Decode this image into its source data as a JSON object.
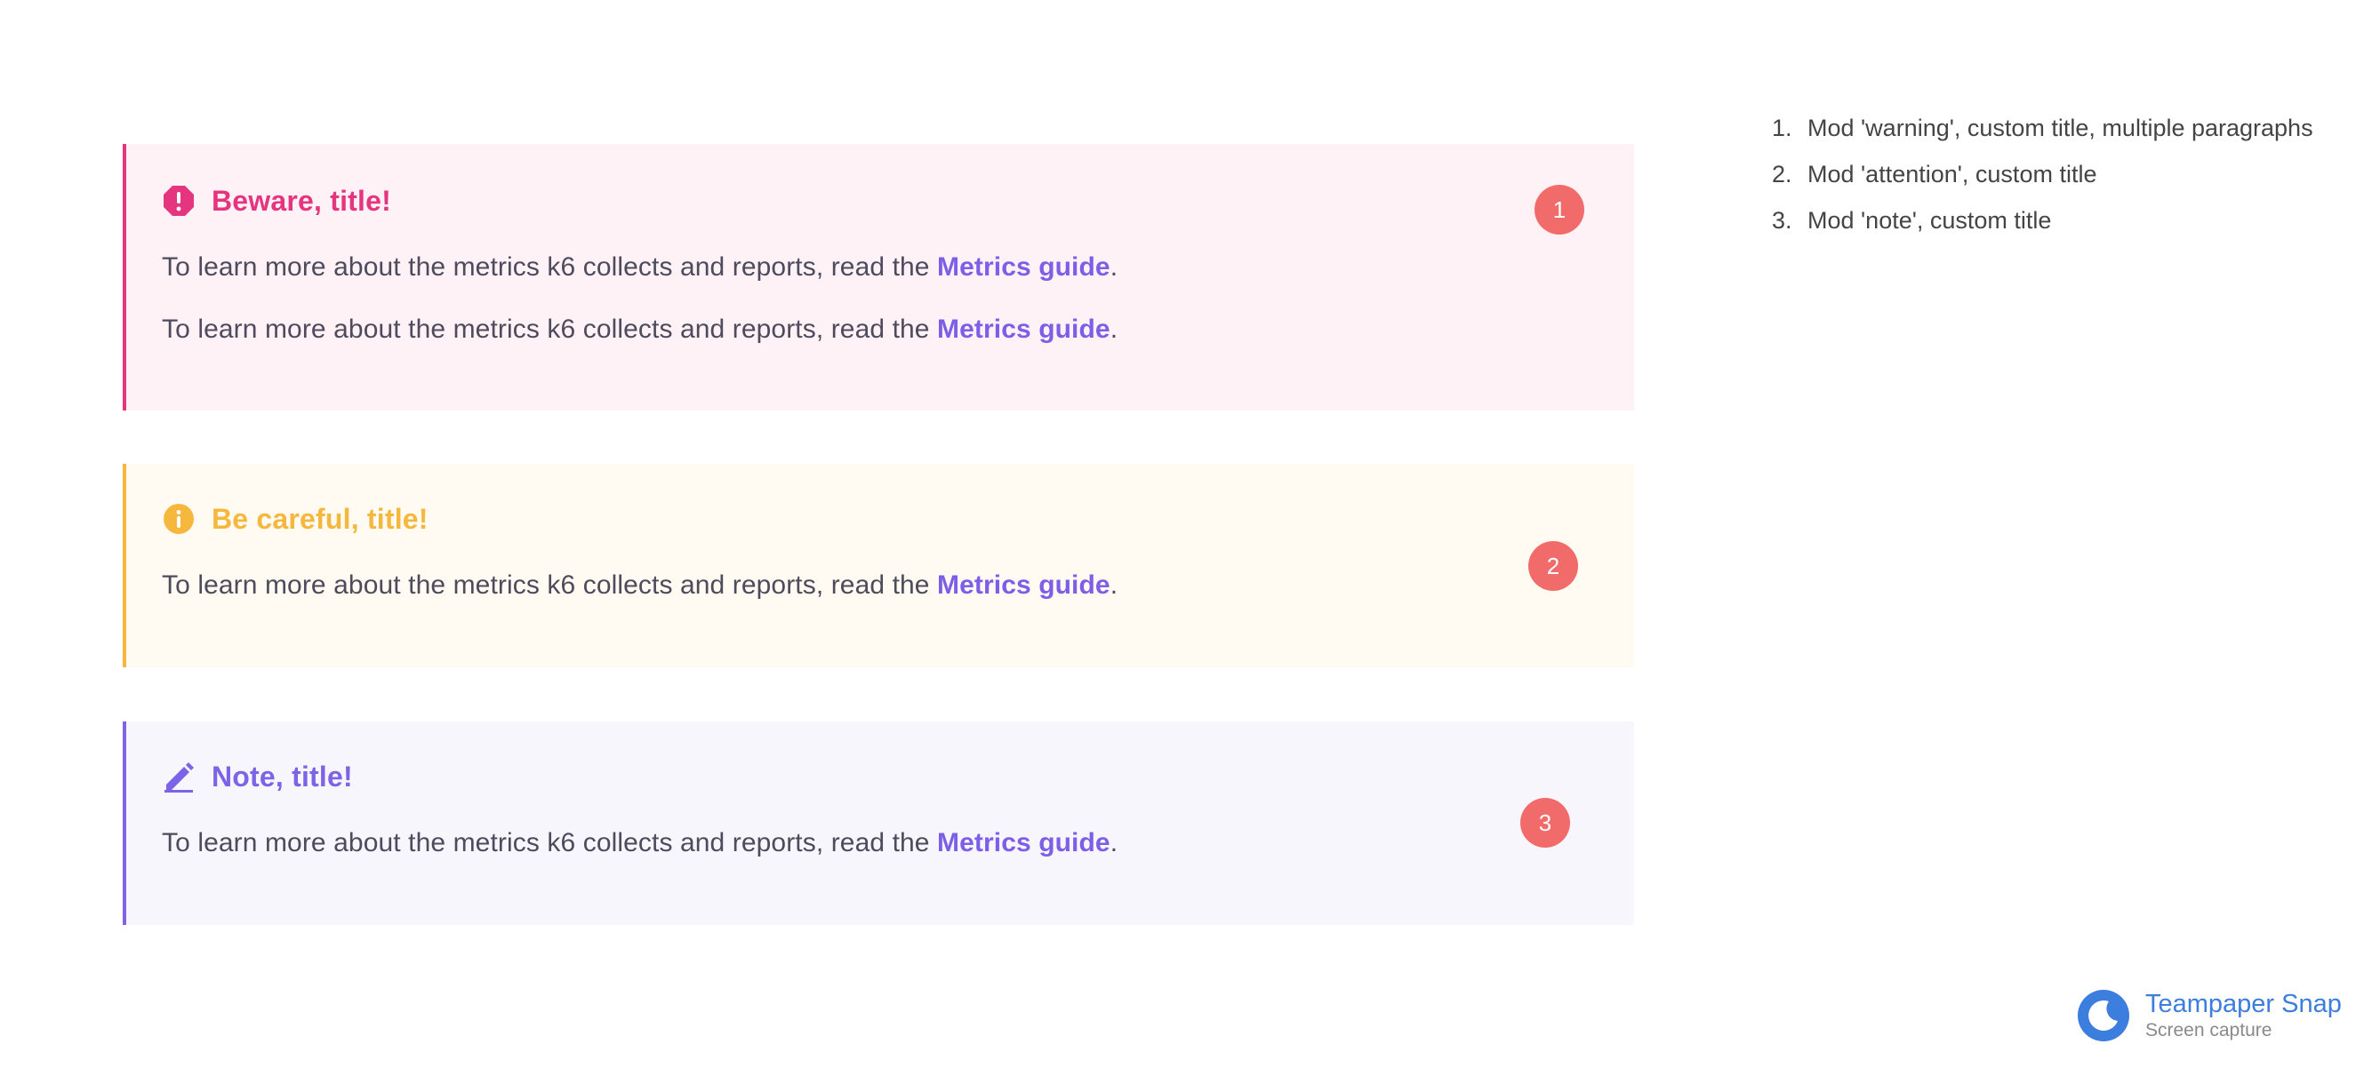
{
  "callouts": [
    {
      "title": "Beware, title!",
      "icon": "warning-octagon-icon",
      "accent": "#e6357f",
      "background": "#fff2f7",
      "paragraphs": [
        {
          "text": "To learn more about the metrics k6 collects and reports, read the ",
          "link": "Metrics guide",
          "suffix": "."
        },
        {
          "text": "To learn more about the metrics k6 collects and reports, read the ",
          "link": "Metrics guide",
          "suffix": "."
        }
      ],
      "badge": "1"
    },
    {
      "title": "Be careful, title!",
      "icon": "info-circle-icon",
      "accent": "#f5b83d",
      "background": "#fffaf2",
      "paragraphs": [
        {
          "text": "To learn more about the metrics k6 collects and reports, read the ",
          "link": "Metrics guide",
          "suffix": "."
        }
      ],
      "badge": "2"
    },
    {
      "title": "Note, title!",
      "icon": "pencil-icon",
      "accent": "#7d64e6",
      "background": "#f8f6fd",
      "paragraphs": [
        {
          "text": "To learn more about the metrics k6 collects and reports, read the ",
          "link": "Metrics guide",
          "suffix": "."
        }
      ],
      "badge": "3"
    }
  ],
  "legend": [
    {
      "num": "1.",
      "text": "Mod 'warning', custom title, multiple paragraphs"
    },
    {
      "num": "2.",
      "text": "Mod 'attention', custom title"
    },
    {
      "num": "3.",
      "text": "Mod 'note', custom title"
    }
  ],
  "brand": {
    "name": "Teampaper Snap",
    "subtitle": "Screen capture",
    "icon": "teampaper-logo-icon"
  },
  "colors": {
    "link": "#7d5ee6",
    "badge": "#f26b6b",
    "brand": "#3c7ede"
  }
}
